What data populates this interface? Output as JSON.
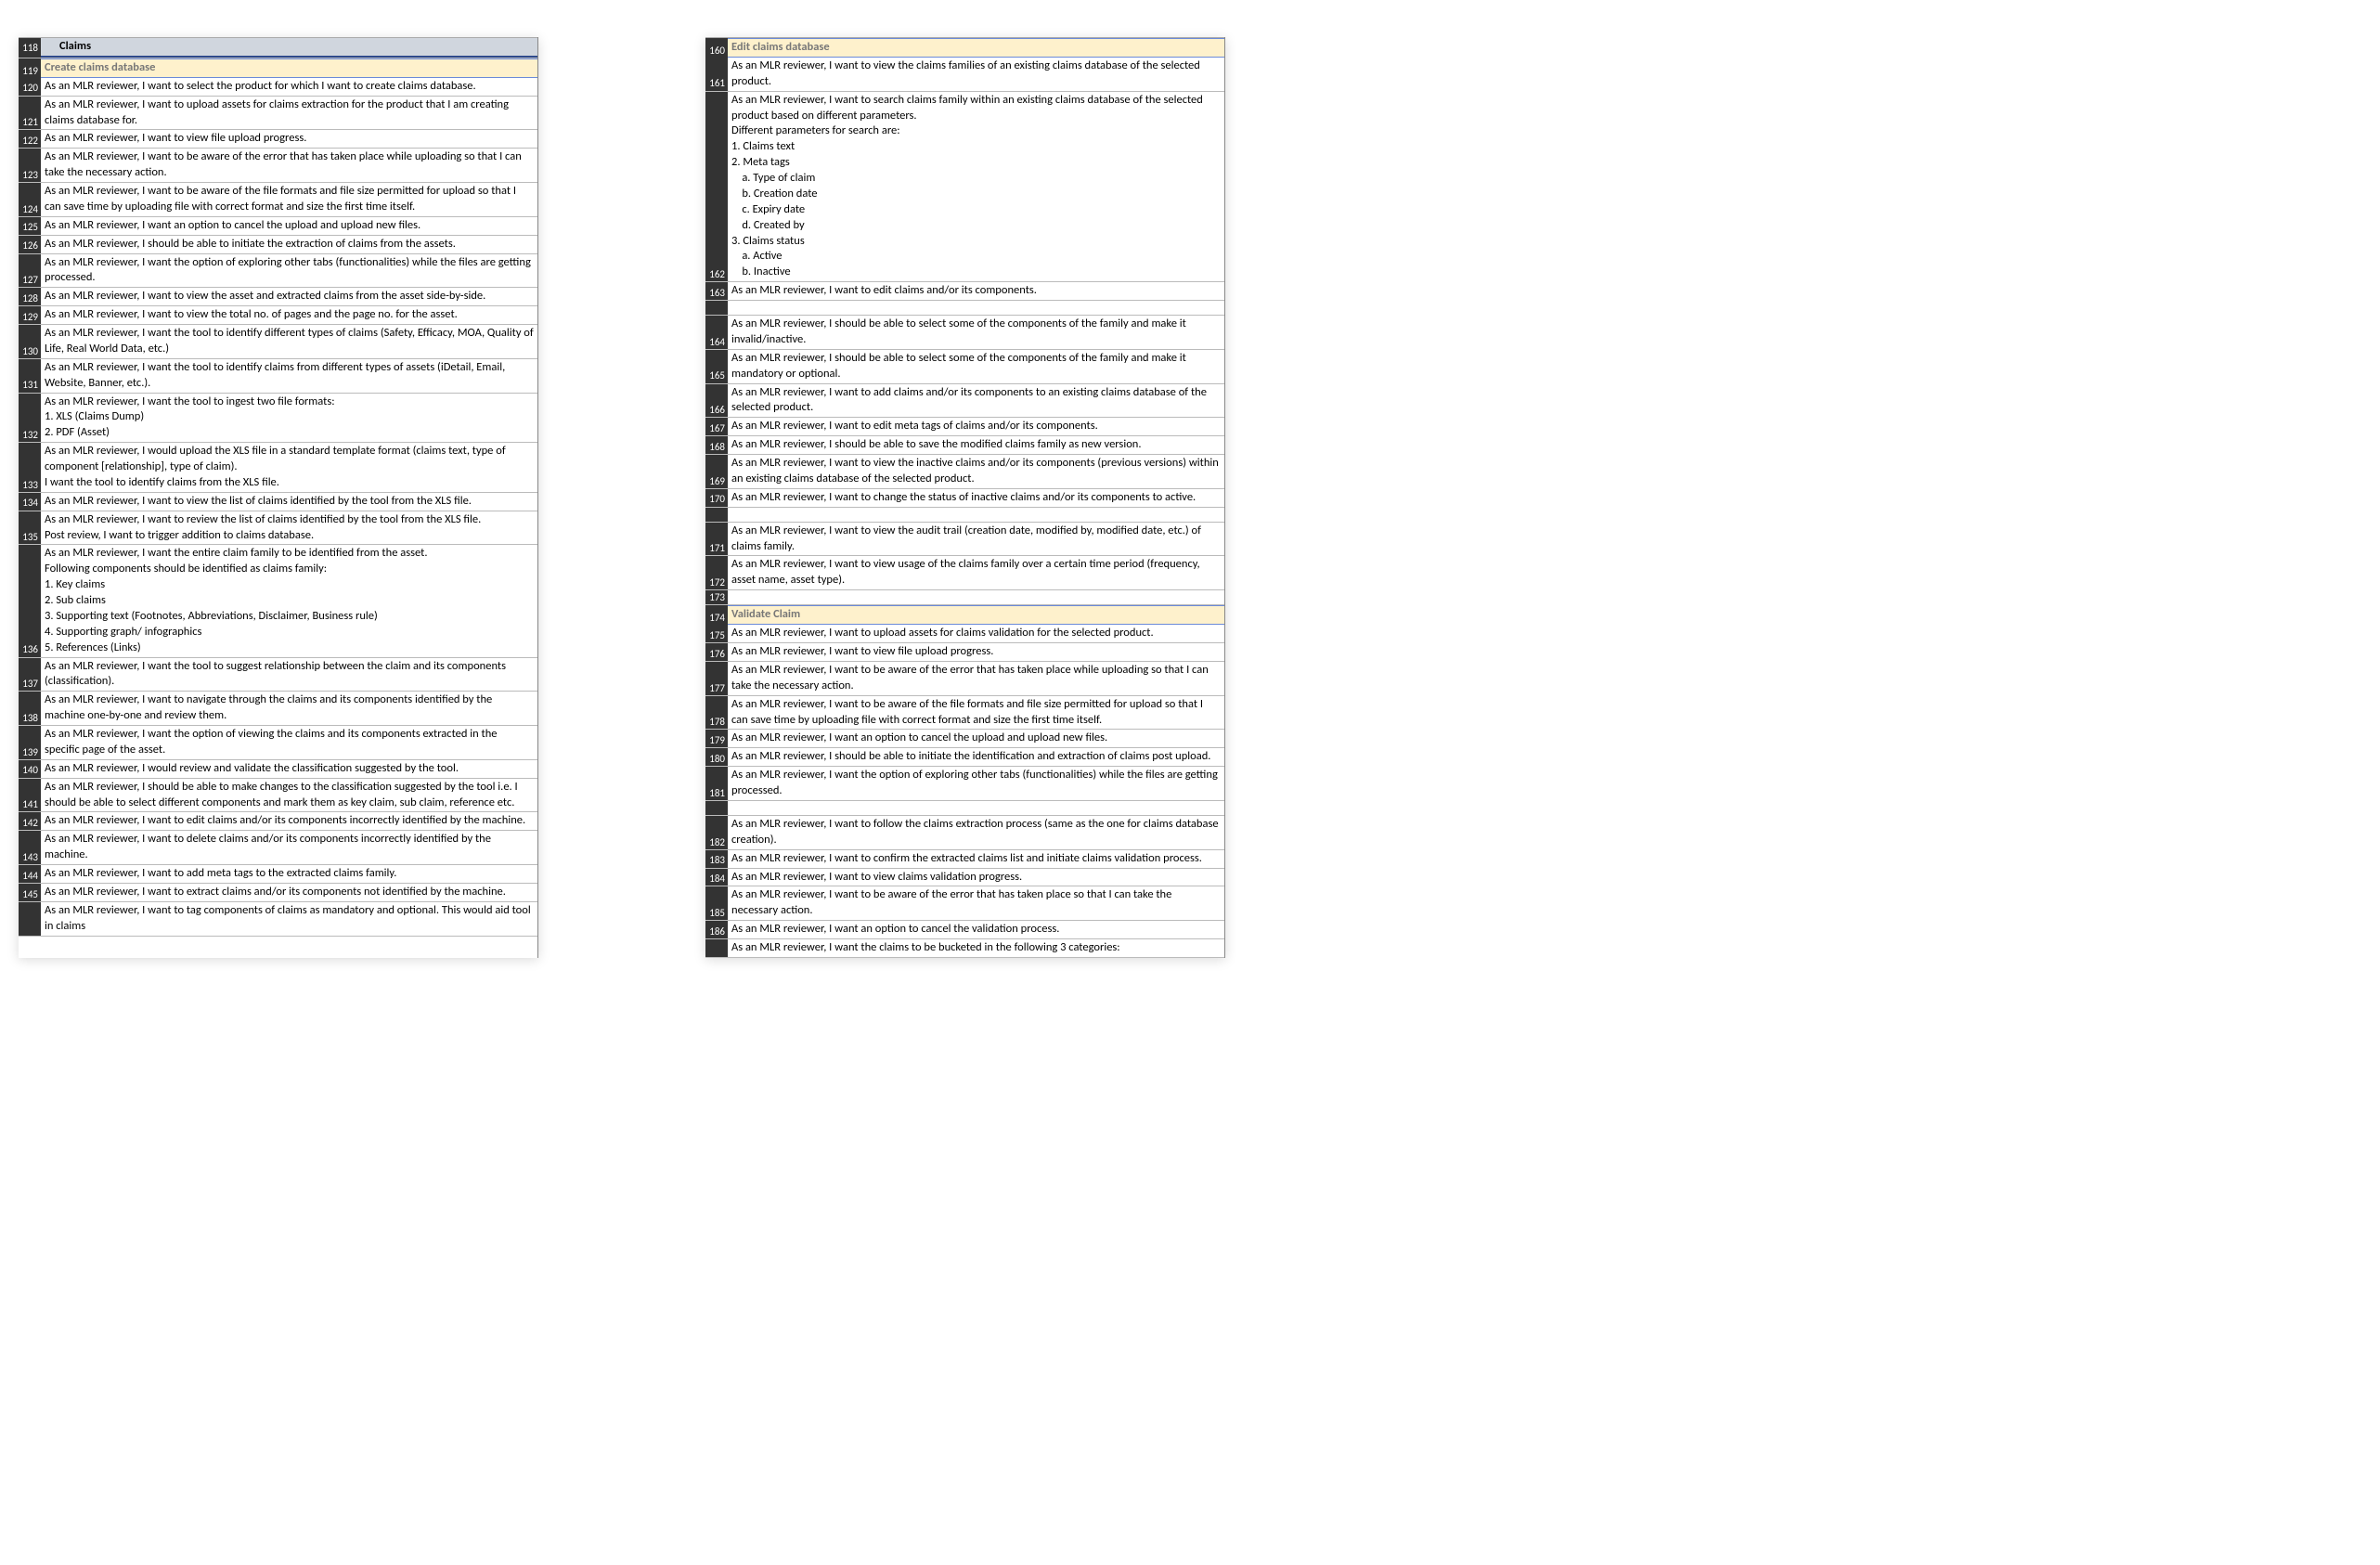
{
  "left": [
    {
      "num": "118",
      "style": "header-main",
      "text": "Claims"
    },
    {
      "num": "119",
      "style": "header-sub",
      "text": "Create claims database"
    },
    {
      "num": "120",
      "text": "As an MLR reviewer, I want to select the product for which I want to create claims database."
    },
    {
      "num": "121",
      "text": "As an MLR reviewer, I want to upload assets for claims extraction for the product that I am creating claims database for."
    },
    {
      "num": "122",
      "text": "As an MLR reviewer, I want to view file upload progress."
    },
    {
      "num": "123",
      "text": "As an MLR reviewer, I want to be aware of the error that has taken place while uploading so that I can take the necessary action."
    },
    {
      "num": "124",
      "text": "As an MLR reviewer, I want to be aware of the file formats and file size permitted for upload so that I can save time by uploading file with correct format and size the first time itself."
    },
    {
      "num": "125",
      "text": "As an MLR reviewer, I want an option to cancel the upload and upload new files."
    },
    {
      "num": "126",
      "text": "As an MLR reviewer, I should be able to initiate the extraction of claims from the assets."
    },
    {
      "num": "127",
      "text": "As an MLR reviewer, I want the option of exploring other tabs (functionalities) while the files are getting processed."
    },
    {
      "num": "128",
      "text": "As an MLR reviewer, I want to view the asset and extracted claims from the asset side-by-side."
    },
    {
      "num": "129",
      "text": "As an MLR reviewer, I want to view the total no. of pages and the page no. for the asset."
    },
    {
      "num": "130",
      "text": "As an MLR reviewer, I want the tool to identify different types of claims (Safety, Efficacy, MOA, Quality of Life, Real World Data, etc.)"
    },
    {
      "num": "131",
      "text": "As an MLR reviewer, I want the tool to identify claims from different types of assets (iDetail, Email, Website, Banner, etc.)."
    },
    {
      "num": "132",
      "text": "As an MLR reviewer, I want the tool to ingest two file formats:\n1. XLS (Claims Dump)\n2. PDF (Asset)"
    },
    {
      "num": "133",
      "text": "As an MLR reviewer, I would upload the XLS file in a standard template format (claims text, type of component [relationship], type of claim).\nI want the tool to identify claims from the XLS file."
    },
    {
      "num": "134",
      "text": "As an MLR reviewer, I want to view the list of claims identified by the tool from the XLS file."
    },
    {
      "num": "135",
      "text": "As an MLR reviewer, I want to review the list of claims identified by the tool from the XLS file.\nPost review, I want to trigger addition to claims database."
    },
    {
      "num": "136",
      "text": "As an MLR reviewer, I want the entire claim family to be identified from the asset.\nFollowing components should be identified as claims family:\n1. Key claims\n2. Sub claims\n3. Supporting text (Footnotes, Abbreviations, Disclaimer, Business rule)\n4. Supporting graph/ infographics\n5. References (Links)"
    },
    {
      "num": "137",
      "text": "As an MLR reviewer, I want the tool to suggest relationship between the claim and its components (classification)."
    },
    {
      "num": "138",
      "text": "As an MLR reviewer, I want to navigate through the claims and its components identified by the machine one-by-one and review them."
    },
    {
      "num": "139",
      "text": "As an MLR reviewer, I want the option of viewing the claims and its components extracted in the specific page of the asset."
    },
    {
      "num": "140",
      "text": "As an MLR reviewer, I would review and validate the classification suggested by the tool."
    },
    {
      "num": "141",
      "text": "As an MLR reviewer, I should be able to make changes to the classification suggested by the tool i.e. I should be able to select different components and mark them as key claim, sub claim, reference etc."
    },
    {
      "num": "142",
      "text": "As an MLR reviewer, I want to edit claims and/or its components incorrectly identified by the machine."
    },
    {
      "num": "143",
      "text": "As an MLR reviewer, I want to delete claims and/or its components incorrectly identified by the machine."
    },
    {
      "num": "144",
      "text": "As an MLR reviewer, I want to add meta tags to the extracted claims family."
    },
    {
      "num": "145",
      "text": "As an MLR reviewer, I want to extract claims and/or its components not identified by the machine."
    },
    {
      "num": "",
      "text": "As an MLR reviewer, I want to tag components of claims as mandatory and optional. This would aid tool in claims"
    }
  ],
  "right": [
    {
      "num": "160",
      "style": "header-sub",
      "text": "Edit claims database"
    },
    {
      "num": "161",
      "text": "As an MLR reviewer, I want to view the claims families of an existing claims database of the selected product."
    },
    {
      "num": "162",
      "text": "As an MLR reviewer, I want to search claims family within an existing claims database of the selected product based on different parameters.\nDifferent parameters for search are:\n1. Claims text\n2. Meta tags\n    a. Type of claim\n    b. Creation date\n    c. Expiry date\n    d. Created by\n3. Claims status\n    a. Active\n    b. Inactive"
    },
    {
      "num": "163",
      "text": "As an MLR reviewer, I want to edit claims and/or its components."
    },
    {
      "num": "",
      "style": "empty",
      "text": ""
    },
    {
      "num": "164",
      "text": "As an MLR reviewer, I should be able to select some of the components of the family and make it invalid/inactive."
    },
    {
      "num": "165",
      "text": "As an MLR reviewer, I should be able to select some of the components of the family and make it mandatory or optional."
    },
    {
      "num": "166",
      "text": "As an MLR reviewer, I want to add claims and/or its components to an existing claims database of the selected product."
    },
    {
      "num": "167",
      "text": "As an MLR reviewer, I want to edit meta tags of claims and/or its components."
    },
    {
      "num": "168",
      "text": "As an MLR reviewer, I should be able to save the modified claims family as new version."
    },
    {
      "num": "169",
      "text": "As an MLR reviewer, I want to view the inactive claims and/or its components (previous versions) within an existing claims database of the selected product."
    },
    {
      "num": "170",
      "text": "As an MLR reviewer, I want to change the status of inactive claims and/or its components to active."
    },
    {
      "num": "",
      "style": "empty",
      "text": ""
    },
    {
      "num": "171",
      "text": "As an MLR reviewer, I want to view the audit trail (creation date, modified by, modified date, etc.) of claims family."
    },
    {
      "num": "172",
      "text": "As an MLR reviewer, I want to view usage of the claims family over a certain time period (frequency, asset name, asset type)."
    },
    {
      "num": "173",
      "style": "empty",
      "text": ""
    },
    {
      "num": "174",
      "style": "header-sub",
      "text": "Validate Claim"
    },
    {
      "num": "175",
      "text": "As an MLR reviewer, I want to upload assets for claims validation for the selected product."
    },
    {
      "num": "176",
      "text": "As an MLR reviewer, I want to view file upload progress."
    },
    {
      "num": "177",
      "text": "As an MLR reviewer, I want to be aware of the error that has taken place while uploading so that I can take the necessary action."
    },
    {
      "num": "178",
      "text": "As an MLR reviewer, I want to be aware of the file formats and file size permitted for upload so that I can save time by uploading file with correct format and size the first time itself."
    },
    {
      "num": "179",
      "text": "As an MLR reviewer, I want an option to cancel the upload and upload new files."
    },
    {
      "num": "180",
      "text": "As an MLR reviewer, I should be able to initiate the identification and extraction of claims post upload."
    },
    {
      "num": "181",
      "text": "As an MLR reviewer, I want the option of exploring other tabs (functionalities) while the files are getting processed."
    },
    {
      "num": "",
      "style": "empty",
      "text": ""
    },
    {
      "num": "182",
      "text": "As an MLR reviewer, I want to follow the claims extraction process (same as the one for claims database creation)."
    },
    {
      "num": "183",
      "text": "As an MLR reviewer, I want to confirm the extracted claims list and initiate claims validation process."
    },
    {
      "num": "184",
      "text": "As an MLR reviewer, I want to view claims validation progress."
    },
    {
      "num": "185",
      "text": "As an MLR reviewer, I want to be aware of the error that has taken place so that I can take the necessary action."
    },
    {
      "num": "186",
      "text": "As an MLR reviewer, I want an option to cancel the validation process."
    },
    {
      "num": "",
      "text": "As an MLR reviewer, I want the claims to be bucketed in the following 3 categories:"
    }
  ]
}
